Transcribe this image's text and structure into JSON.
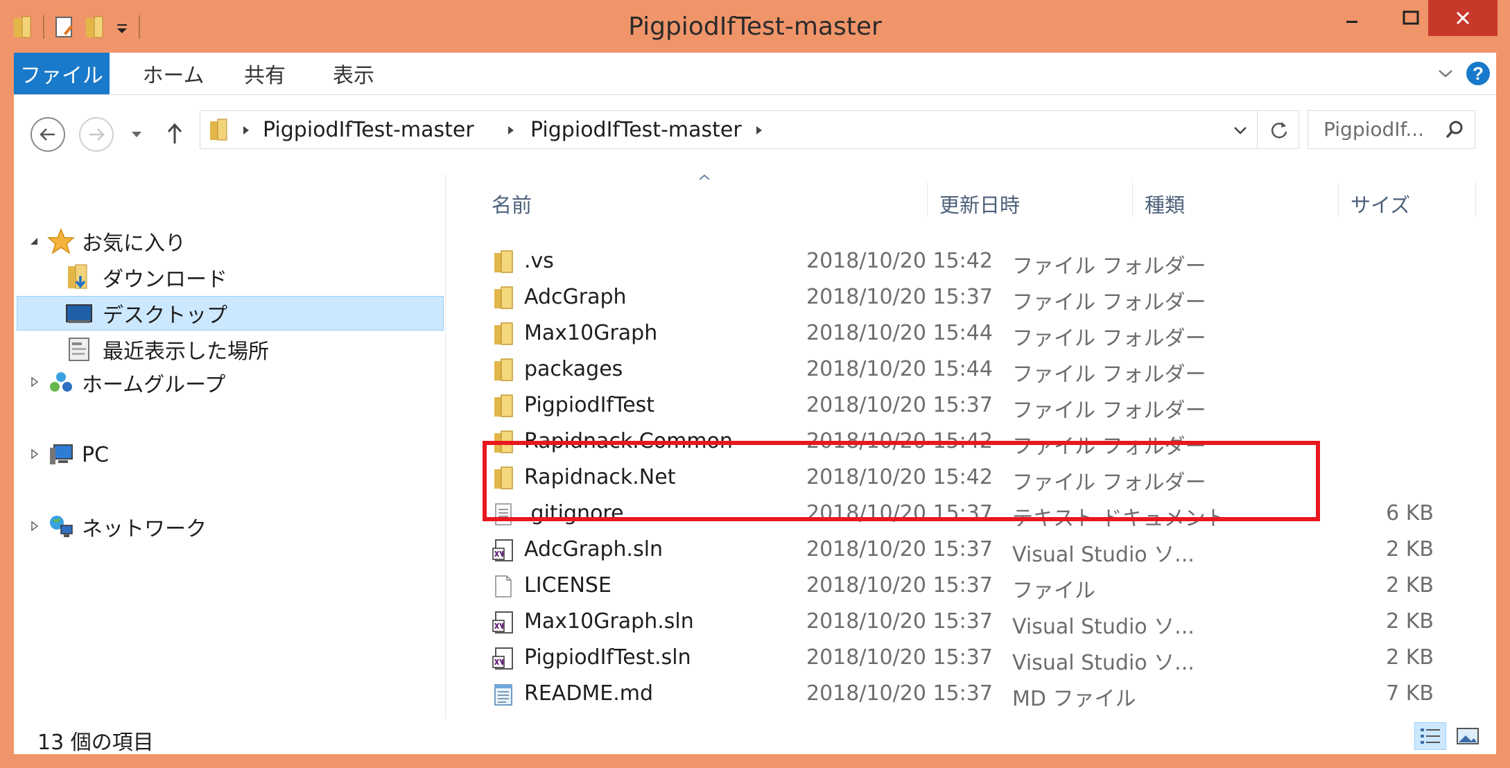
{
  "window": {
    "title": "PigpiodIfTest-master"
  },
  "ribbon": {
    "tabs": [
      {
        "label": "ファイル"
      },
      {
        "label": "ホーム"
      },
      {
        "label": "共有"
      },
      {
        "label": "表示"
      }
    ]
  },
  "address": {
    "crumbs": [
      "PigpiodIfTest-master",
      "PigpiodIfTest-master"
    ],
    "search_placeholder": "PigpiodIf..."
  },
  "nav": {
    "favorites_label": "お気に入り",
    "downloads": "ダウンロード",
    "desktop": "デスクトップ",
    "recent": "最近表示した場所",
    "homegroup": "ホームグループ",
    "pc": "PC",
    "network": "ネットワーク"
  },
  "columns": {
    "name": "名前",
    "date": "更新日時",
    "type": "種類",
    "size": "サイズ"
  },
  "files": [
    {
      "name": ".vs",
      "date": "2018/10/20 15:42",
      "type": "ファイル フォルダー",
      "size": "",
      "icon": "folder-icon"
    },
    {
      "name": "AdcGraph",
      "date": "2018/10/20 15:37",
      "type": "ファイル フォルダー",
      "size": "",
      "icon": "folder-icon"
    },
    {
      "name": "Max10Graph",
      "date": "2018/10/20 15:44",
      "type": "ファイル フォルダー",
      "size": "",
      "icon": "folder-icon"
    },
    {
      "name": "packages",
      "date": "2018/10/20 15:44",
      "type": "ファイル フォルダー",
      "size": "",
      "icon": "folder-icon"
    },
    {
      "name": "PigpiodIfTest",
      "date": "2018/10/20 15:37",
      "type": "ファイル フォルダー",
      "size": "",
      "icon": "folder-icon"
    },
    {
      "name": "Rapidnack.Common",
      "date": "2018/10/20 15:42",
      "type": "ファイル フォルダー",
      "size": "",
      "icon": "folder-icon"
    },
    {
      "name": "Rapidnack.Net",
      "date": "2018/10/20 15:42",
      "type": "ファイル フォルダー",
      "size": "",
      "icon": "folder-icon"
    },
    {
      "name": ".gitignore",
      "date": "2018/10/20 15:37",
      "type": "テキスト ドキュメント",
      "size": "6 KB",
      "icon": "text-file-icon"
    },
    {
      "name": "AdcGraph.sln",
      "date": "2018/10/20 15:37",
      "type": "Visual Studio ソ...",
      "size": "2 KB",
      "icon": "vs-solution-icon"
    },
    {
      "name": "LICENSE",
      "date": "2018/10/20 15:37",
      "type": "ファイル",
      "size": "2 KB",
      "icon": "blank-file-icon"
    },
    {
      "name": "Max10Graph.sln",
      "date": "2018/10/20 15:37",
      "type": "Visual Studio ソ...",
      "size": "2 KB",
      "icon": "vs-solution-icon"
    },
    {
      "name": "PigpiodIfTest.sln",
      "date": "2018/10/20 15:37",
      "type": "Visual Studio ソ...",
      "size": "2 KB",
      "icon": "vs-solution-icon"
    },
    {
      "name": "README.md",
      "date": "2018/10/20 15:37",
      "type": "MD ファイル",
      "size": "7 KB",
      "icon": "notepad-file-icon"
    }
  ],
  "status": {
    "count": "13 個の項目"
  },
  "colors": {
    "frame": "#f0956a",
    "file_tab": "#1979ca",
    "selection": "#cce8ff",
    "highlight_box": "#e8181f",
    "close": "#c7382b"
  }
}
